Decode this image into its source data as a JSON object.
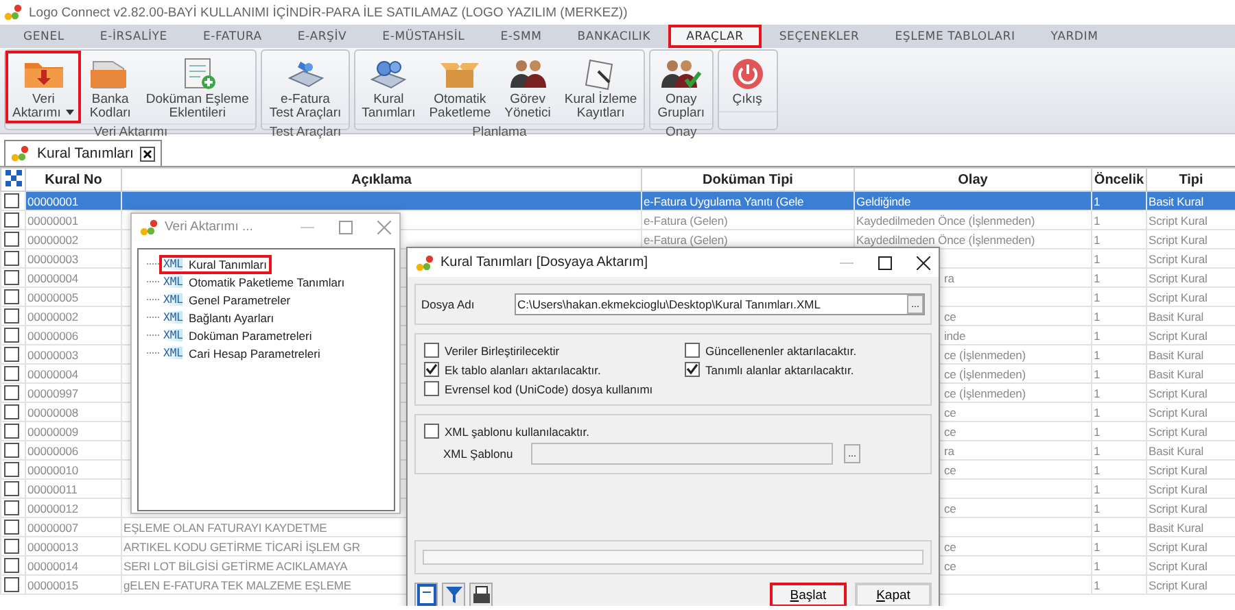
{
  "window": {
    "title": "Logo Connect v2.82.00-BAYİ KULLANIMI İÇİNDİR-PARA İLE SATILAMAZ (LOGO YAZILIM (MERKEZ))"
  },
  "menu_tabs": [
    {
      "label": "GENEL",
      "selected": false,
      "highlighted": false
    },
    {
      "label": "E-İRSALİYE",
      "selected": false,
      "highlighted": false
    },
    {
      "label": "E-FATURA",
      "selected": false,
      "highlighted": false
    },
    {
      "label": "E-ARŞİV",
      "selected": false,
      "highlighted": false
    },
    {
      "label": "E-MÜSTAHSİL",
      "selected": false,
      "highlighted": false
    },
    {
      "label": "E-SMM",
      "selected": false,
      "highlighted": false
    },
    {
      "label": "BANKACILIK",
      "selected": false,
      "highlighted": false
    },
    {
      "label": "ARAÇLAR",
      "selected": true,
      "highlighted": true
    },
    {
      "label": "SEÇENEKLER",
      "selected": false,
      "highlighted": false
    },
    {
      "label": "EŞLEME TABLOLARI",
      "selected": false,
      "highlighted": false
    },
    {
      "label": "YARDIM",
      "selected": false,
      "highlighted": false
    }
  ],
  "ribbon": {
    "groups": [
      {
        "label": "Veri Aktarımı",
        "buttons": [
          {
            "label": "Veri\nAktarımı",
            "dropdown": true,
            "highlighted": true
          },
          {
            "label": "Banka\nKodları",
            "dropdown": false,
            "highlighted": false
          },
          {
            "label": "Doküman Eşleme\nEklentileri",
            "dropdown": false,
            "highlighted": false
          }
        ]
      },
      {
        "label": "Test Araçları",
        "buttons": [
          {
            "label": "e-Fatura\nTest Araçları",
            "dropdown": false,
            "highlighted": false
          }
        ]
      },
      {
        "label": "Planlama",
        "buttons": [
          {
            "label": "Kural\nTanımları",
            "dropdown": false,
            "highlighted": false
          },
          {
            "label": "Otomatik\nPaketleme",
            "dropdown": false,
            "highlighted": false
          },
          {
            "label": "Görev\nYönetici",
            "dropdown": false,
            "highlighted": false
          },
          {
            "label": "Kural İzleme\nKayıtları",
            "dropdown": false,
            "highlighted": false
          }
        ]
      },
      {
        "label": "Onay",
        "buttons": [
          {
            "label": "Onay\nGrupları",
            "dropdown": false,
            "highlighted": false
          }
        ]
      },
      {
        "buttons": [
          {
            "label": "Çıkış",
            "dropdown": false,
            "highlighted": false
          }
        ]
      }
    ]
  },
  "document_tab": {
    "label": "Kural Tanımları"
  },
  "table": {
    "columns": [
      "Kural No",
      "Açıklama",
      "Doküman Tipi",
      "Olay",
      "Öncelik",
      "Tipi"
    ],
    "rows": [
      {
        "selected": true,
        "checked": false,
        "kural_no": "00000001",
        "dokuman_tipi": "e-Fatura Uygulama Yanıtı (Gele",
        "olay": "Geldiğinde",
        "oncelik": "1",
        "tipi": "Basit Kural"
      },
      {
        "selected": false,
        "checked": false,
        "kural_no": "00000001",
        "dokuman_tipi": "e-Fatura (Gelen)",
        "olay": "Kaydedilmeden Önce (İşlenmeden)",
        "oncelik": "1",
        "tipi": "Script Kural"
      },
      {
        "selected": false,
        "checked": false,
        "kural_no": "00000002",
        "dokuman_tipi": "e-Fatura (Gelen)",
        "olay": "Kaydedilmeden Önce (İşlenmeden)",
        "oncelik": "1",
        "tipi": "Script Kural"
      },
      {
        "selected": false,
        "checked": false,
        "kural_no": "00000003",
        "oncelik": "1",
        "tipi": "Script Kural"
      },
      {
        "selected": false,
        "checked": false,
        "kural_no": "00000004",
        "olay_tail": "ra",
        "oncelik": "1",
        "tipi": "Script Kural"
      },
      {
        "selected": false,
        "checked": false,
        "kural_no": "00000005",
        "oncelik": "1",
        "tipi": "Script Kural"
      },
      {
        "selected": false,
        "checked": false,
        "kural_no": "00000002",
        "olay_tail": "ce",
        "oncelik": "1",
        "tipi": "Basit Kural"
      },
      {
        "selected": false,
        "checked": false,
        "kural_no": "00000006",
        "olay_tail": "inde",
        "oncelik": "1",
        "tipi": "Script Kural"
      },
      {
        "selected": false,
        "checked": false,
        "kural_no": "00000003",
        "olay_tail": "ce (İşlenmeden)",
        "oncelik": "1",
        "tipi": "Basit Kural"
      },
      {
        "selected": false,
        "checked": false,
        "kural_no": "00000004",
        "olay_tail": "ce (İşlenmeden)",
        "oncelik": "1",
        "tipi": "Basit Kural"
      },
      {
        "selected": false,
        "checked": false,
        "kural_no": "00000997",
        "olay_tail": "ce (İşlenmeden)",
        "oncelik": "1",
        "tipi": "Script Kural"
      },
      {
        "selected": false,
        "checked": false,
        "kural_no": "00000008",
        "olay_tail": "ce",
        "oncelik": "1",
        "tipi": "Script Kural"
      },
      {
        "selected": false,
        "checked": false,
        "kural_no": "00000009",
        "olay_tail": "ce",
        "oncelik": "1",
        "tipi": "Script Kural"
      },
      {
        "selected": false,
        "checked": false,
        "kural_no": "00000006",
        "olay_tail": "ra",
        "oncelik": "1",
        "tipi": "Basit Kural"
      },
      {
        "selected": false,
        "checked": false,
        "kural_no": "00000010",
        "olay_tail": "ce",
        "oncelik": "1",
        "tipi": "Script Kural"
      },
      {
        "selected": false,
        "checked": false,
        "kural_no": "00000011",
        "oncelik": "1",
        "tipi": "Script Kural"
      },
      {
        "selected": false,
        "checked": false,
        "kural_no": "00000012",
        "olay_tail": "ce",
        "oncelik": "1",
        "tipi": "Script Kural"
      },
      {
        "selected": false,
        "checked": false,
        "kural_no": "00000007",
        "aciklama": "EŞLEME OLAN FATURAYI KAYDETME",
        "oncelik": "1",
        "tipi": "Basit Kural"
      },
      {
        "selected": false,
        "checked": false,
        "kural_no": "00000013",
        "aciklama": "ARTIKEL KODU GETİRME TİCARİ İŞLEM GR",
        "olay_tail": "ce",
        "oncelik": "1",
        "tipi": "Script Kural"
      },
      {
        "selected": false,
        "checked": false,
        "kural_no": "00000014",
        "aciklama": "SERI LOT BİLGİSİ GETİRME ACIKLAMAYA",
        "olay_tail": "ce",
        "oncelik": "1",
        "tipi": "Script Kural"
      },
      {
        "selected": false,
        "checked": false,
        "kural_no": "00000015",
        "aciklama": "gELEN E-FATURA TEK MALZEME EŞLEME",
        "oncelik": "1",
        "tipi": "Script Kural"
      }
    ]
  },
  "tree_dialog": {
    "title": "Veri Aktarımı ...",
    "items": [
      {
        "icon_label": "XML",
        "label": "Kural Tanımları",
        "highlighted": true
      },
      {
        "icon_label": "XML",
        "label": "Otomatik Paketleme Tanımları",
        "highlighted": false
      },
      {
        "icon_label": "XML",
        "label": "Genel Parametreler",
        "highlighted": false
      },
      {
        "icon_label": "XML",
        "label": "Bağlantı Ayarları",
        "highlighted": false
      },
      {
        "icon_label": "XML",
        "label": "Doküman Parametreleri",
        "highlighted": false
      },
      {
        "icon_label": "XML",
        "label": "Cari Hesap Parametreleri",
        "highlighted": false
      }
    ]
  },
  "export_dialog": {
    "title": "Kural Tanımları [Dosyaya Aktarım]",
    "file": {
      "label": "Dosya Adı",
      "value": "C:\\Users\\hakan.ekmekcioglu\\Desktop\\Kural Tanımları.XML",
      "browse": "..."
    },
    "options": [
      {
        "label": "Veriler Birleştirilecektir",
        "checked": false
      },
      {
        "label": "Güncellenenler aktarılacaktır.",
        "checked": false
      },
      {
        "label": "Ek tablo alanları aktarılacaktır.",
        "checked": true
      },
      {
        "label": "Tanımlı alanlar aktarılacaktır.",
        "checked": true
      },
      {
        "label": "Evrensel kod (UniCode) dosya kullanımı",
        "checked": false
      }
    ],
    "template": {
      "label": "XML şablonu kullanılacaktır.",
      "checked": false,
      "field_label": "XML Şablonu",
      "browse": "..."
    },
    "progress": {
      "level": 0
    },
    "buttons": [
      {
        "label": "Başlat",
        "highlighted": true
      },
      {
        "label": "Kapat",
        "highlighted": false
      }
    ]
  }
}
